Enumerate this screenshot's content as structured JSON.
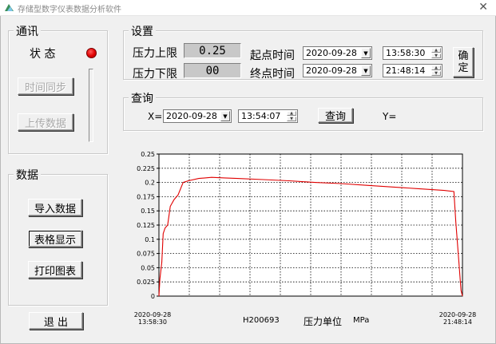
{
  "window": {
    "title": "存储型数字仪表数据分析软件",
    "close_glyph": "✕"
  },
  "comm": {
    "legend": "通讯",
    "status_label": "状  态",
    "status_color": "#e00000",
    "time_sync_label": "时间同步",
    "upload_label": "上传数据"
  },
  "data_group": {
    "legend": "数据",
    "import_label": "导入数据",
    "table_label": "表格显示",
    "print_label": "打印图表"
  },
  "exit_label": "退  出",
  "settings": {
    "legend": "设置",
    "upper_label": "压力上限",
    "upper_value": "0.25",
    "lower_label": "压力下限",
    "lower_value": "00",
    "start_label": "起点时间",
    "start_date": "2020-09-28",
    "start_time": "13:58:30",
    "end_label": "终点时间",
    "end_date": "2020-09-28",
    "end_time": "21:48:14",
    "confirm_label": "确\n定"
  },
  "query": {
    "legend": "查询",
    "x_label": "X=",
    "date": "2020-09-28",
    "time": "13:54:07",
    "button_label": "查询",
    "y_label": "Y="
  },
  "chart_footer": {
    "start_date": "2020-09-28",
    "start_time": "13:58:30",
    "end_date": "2020-09-28",
    "end_time": "21:48:14",
    "device_id": "H200693",
    "unit_label": "压力单位",
    "unit": "MPa"
  },
  "chart_data": {
    "type": "line",
    "title": "",
    "xlabel": "",
    "ylabel": "",
    "xlim": [
      "2020-09-28 13:58:30",
      "2020-09-28 21:48:14"
    ],
    "ylim": [
      0,
      0.25
    ],
    "yticks": [
      "0.25",
      "0.225",
      "0.2",
      "0.175",
      "0.15",
      "0.125",
      "0.1",
      "0.075",
      "0.05",
      "0.025",
      "0"
    ],
    "grid": true,
    "grid_style": "dotted",
    "x_divisions": 10,
    "line_color": "#e00000",
    "series": [
      {
        "x": [
          "13:58:30",
          "14:00:00",
          "14:03:00",
          "14:05:00",
          "14:08:00",
          "14:12:00",
          "14:16:00",
          "14:22:00",
          "14:28:00",
          "14:36:00",
          "14:44:00",
          "15:00:00",
          "15:20:00",
          "15:40:00",
          "16:00:00",
          "16:40:00",
          "17:20:00",
          "18:00:00",
          "18:40:00",
          "19:20:00",
          "20:00:00",
          "20:40:00",
          "21:20:00",
          "21:35:00",
          "21:38:00",
          "21:42:00",
          "21:46:00",
          "21:48:14"
        ],
        "values": [
          0.0,
          0.03,
          0.06,
          0.11,
          0.12,
          0.125,
          0.158,
          0.17,
          0.178,
          0.2,
          0.203,
          0.207,
          0.209,
          0.208,
          0.207,
          0.205,
          0.203,
          0.2,
          0.198,
          0.195,
          0.192,
          0.189,
          0.186,
          0.184,
          0.13,
          0.07,
          0.01,
          0.0
        ]
      }
    ]
  }
}
